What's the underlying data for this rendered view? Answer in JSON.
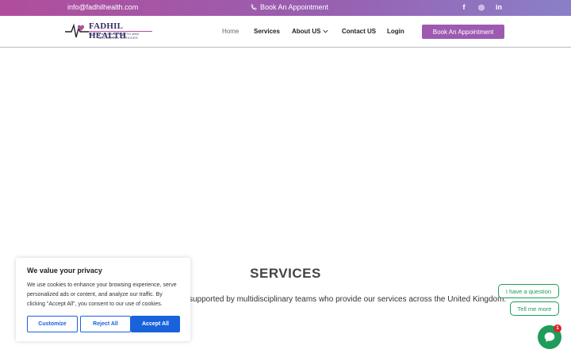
{
  "topbar": {
    "email": "info@fadhilhealth.com",
    "appointment_label": "Book An Appointment",
    "socials": [
      {
        "icon": "facebook-icon",
        "glyph": "f"
      },
      {
        "icon": "instagram-icon",
        "glyph": "◎"
      },
      {
        "icon": "linkedin-icon",
        "glyph": "in"
      }
    ]
  },
  "header": {
    "logo": {
      "brand": "FADHIL HEALTH",
      "tagline_line1": "OCCUPATIONAL HEALTH AND",
      "tagline_line2": "WELLBEING SERVICES"
    },
    "nav": {
      "home": "Home",
      "services": "Services",
      "about": "About US",
      "contact": "Contact US",
      "login": "Login"
    },
    "book_button": "Book An Appointment"
  },
  "main": {
    "section_title": "SERVICES",
    "section_text": "supported by multidisciplinary teams who provide our services across the United Kingdom."
  },
  "cookie_banner": {
    "title": "We value your privacy",
    "text": "We use cookies to enhance your browsing experience, serve personalized ads or content, and analyze our traffic. By clicking \"Accept All\", you consent to our use of cookies.",
    "customize": "Customize",
    "reject": "Reject All",
    "accept": "Accept All"
  },
  "chat": {
    "question_chip": "I have a question",
    "more_chip": "Tell me more",
    "badge_count": "1"
  },
  "colors": {
    "topbar_start": "#b04e9b",
    "topbar_end": "#8a7fc8",
    "accent_purple": "#9e5ab0",
    "cookie_blue": "#1863dc",
    "chat_green": "#1e9c5a"
  }
}
